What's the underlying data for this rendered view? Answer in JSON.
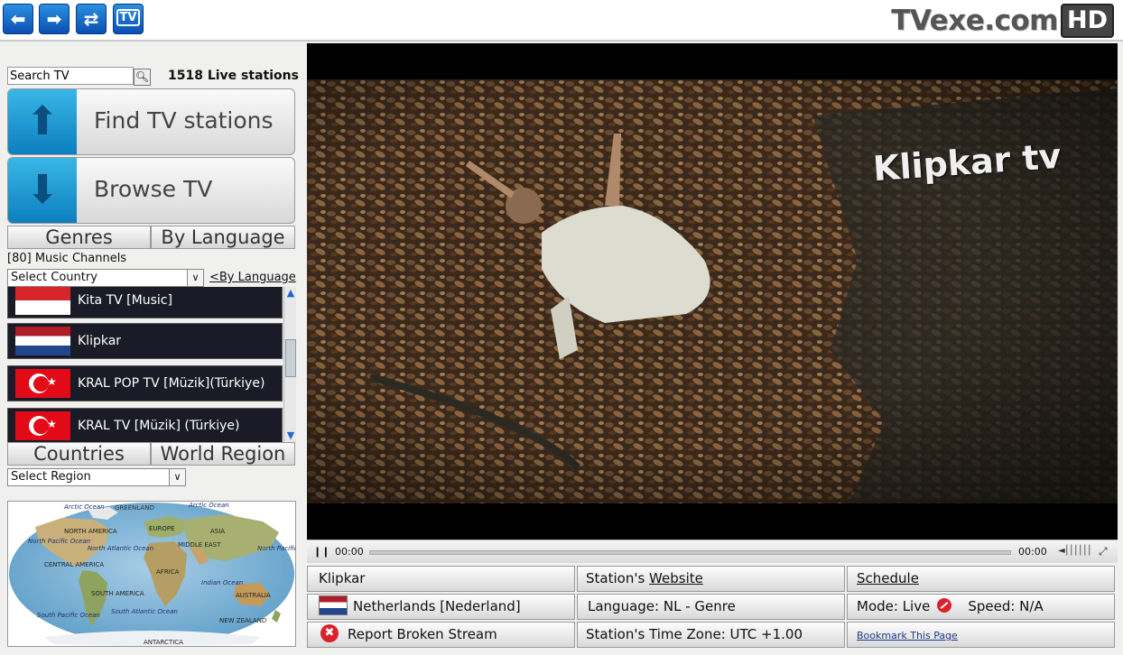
{
  "nav": {
    "back_icon": "back-arrow-icon",
    "forward_icon": "forward-arrow-icon",
    "refresh_icon": "refresh-icon",
    "tv_label": "TV"
  },
  "brand": {
    "name": "TVexe.com",
    "badge": "HD"
  },
  "search": {
    "value": "Search TV",
    "icon": "magnifier-icon"
  },
  "live_count": "1518 Live stations",
  "find_button": {
    "label": "Find TV stations",
    "icon": "up-arrow-icon"
  },
  "browse_button": {
    "label": "Browse TV",
    "icon": "down-arrow-icon"
  },
  "tabs_top": [
    "Genres",
    "By Language"
  ],
  "genre_heading": "[80] Music Channels",
  "country_select": {
    "value": "Select Country"
  },
  "by_language_link": "<By Language",
  "channels": [
    {
      "name": "Kita TV [Music]",
      "flag": "indonesia"
    },
    {
      "name": "Klipkar",
      "flag": "netherlands"
    },
    {
      "name": "KRAL POP TV [Müzik](Türkiye)",
      "flag": "turkey"
    },
    {
      "name": "KRAL TV [Müzik] (Türkiye)",
      "flag": "turkey"
    }
  ],
  "tabs_bottom": [
    "Countries",
    "World Region"
  ],
  "region_select": {
    "value": "Select Region"
  },
  "map_labels": {
    "arctic_w": "Arctic Ocean",
    "greenland": "GREENLAND",
    "arctic_e": "Arctic Ocean",
    "north_america": "NORTH AMERICA",
    "europe": "EUROPE",
    "asia": "ASIA",
    "north_pacific_w": "North Pacific Ocean",
    "north_atlantic": "North Atlantic Ocean",
    "middle_east": "MIDDLE EAST",
    "north_pacific_e": "North Pacific Ocean",
    "central_america": "CENTRAL AMERICA",
    "africa": "AFRICA",
    "indian_ocean": "Indian Ocean",
    "south_america": "SOUTH AMERICA",
    "australia": "AUSTRALIA",
    "south_pacific": "South Pacific Ocean",
    "south_atlantic": "South Atlantic Ocean",
    "new_zealand": "NEW ZEALAND",
    "antarctica": "ANTARCTICA"
  },
  "player": {
    "watermark": "Klipkar tv",
    "time_current": "00:00",
    "time_total": "00:00",
    "progress": 0
  },
  "info": {
    "station_name": "Klipkar",
    "website_prefix": "Station's ",
    "website_link": "Website",
    "schedule_link": "Schedule",
    "country": "Netherlands [Nederland]",
    "language": "Language: NL  - Genre",
    "mode": "Mode: Live",
    "speed": "Speed: N/A",
    "report": "Report Broken Stream",
    "timezone": "Station's Time Zone: UTC +1.00",
    "bookmark": "Bookmark This Page"
  },
  "colors": {
    "accent_blue": "#0a4fb2",
    "list_bg": "#1b1b28",
    "error_red": "#d9222a"
  }
}
